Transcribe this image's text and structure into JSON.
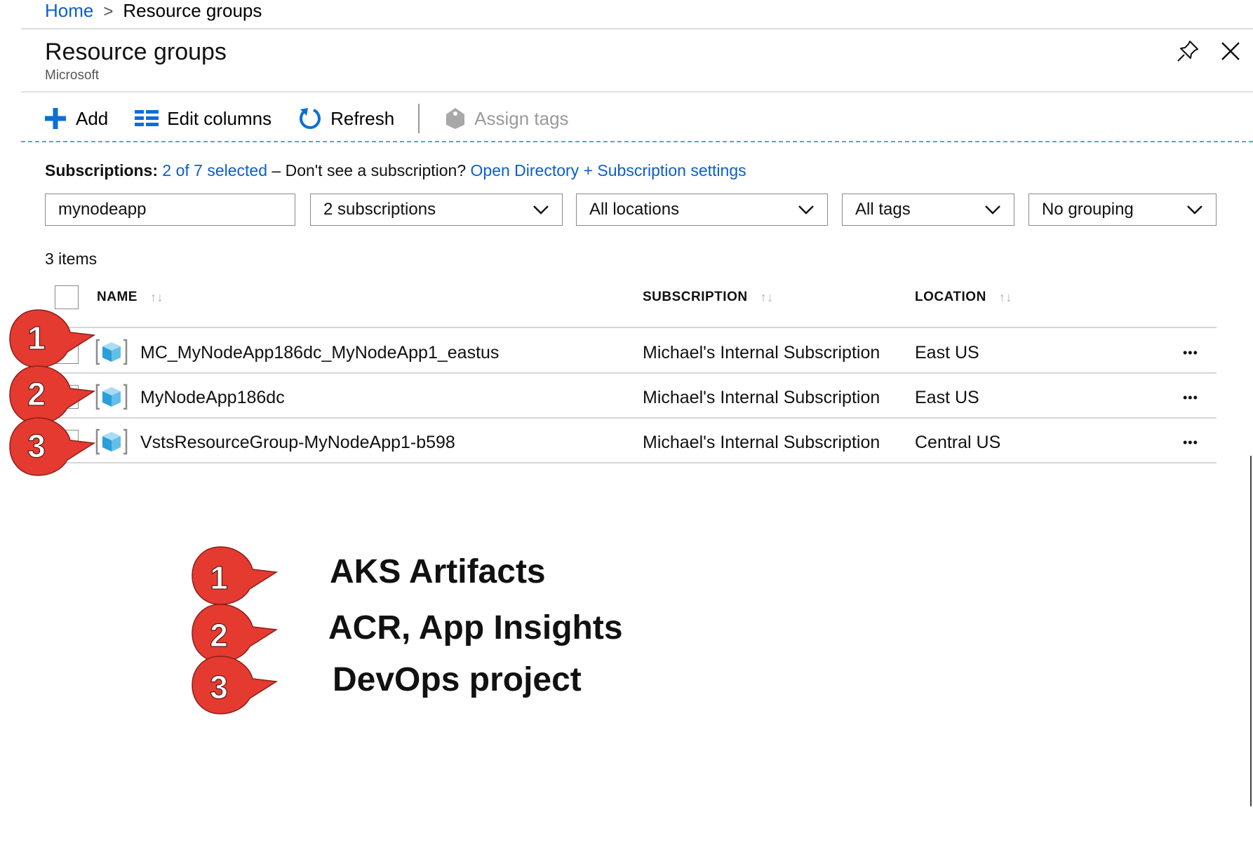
{
  "breadcrumb": {
    "home": "Home",
    "separator": ">",
    "current": "Resource groups"
  },
  "blade": {
    "title": "Resource groups",
    "subtitle": "Microsoft",
    "pin_icon": "pin-icon",
    "close_icon": "close-icon"
  },
  "toolbar": {
    "add": "Add",
    "edit_columns": "Edit columns",
    "refresh": "Refresh",
    "assign_tags": "Assign tags"
  },
  "subscriptions": {
    "label": "Subscriptions:",
    "selected": "2 of 7 selected",
    "dash_text": "– Don't see a subscription?",
    "open_directory": "Open Directory + Subscription settings"
  },
  "filters": {
    "search_value": "mynodeapp",
    "subscriptions": "2 subscriptions",
    "locations": "All locations",
    "tags": "All tags",
    "grouping": "No grouping"
  },
  "items_count": "3 items",
  "table": {
    "columns": [
      "NAME",
      "SUBSCRIPTION",
      "LOCATION"
    ],
    "sort_glyph": "↑↓",
    "more_glyph": "•••",
    "rows": [
      {
        "name": "MC_MyNodeApp186dc_MyNodeApp1_eastus",
        "subscription": "Michael's Internal Subscription",
        "location": "East US"
      },
      {
        "name": "MyNodeApp186dc",
        "subscription": "Michael's Internal Subscription",
        "location": "East US"
      },
      {
        "name": "VstsResourceGroup-MyNodeApp1-b598",
        "subscription": "Michael's Internal Subscription",
        "location": "Central US"
      }
    ]
  },
  "callouts": [
    "1",
    "2",
    "3"
  ],
  "legend": [
    {
      "number": "1",
      "text": "AKS Artifacts"
    },
    {
      "number": "2",
      "text": "ACR, App Insights"
    },
    {
      "number": "3",
      "text": "DevOps project"
    }
  ],
  "colors": {
    "link": "#0b5fcc",
    "callout": "#e53a30",
    "accent_dashed": "#3fb6c0"
  }
}
